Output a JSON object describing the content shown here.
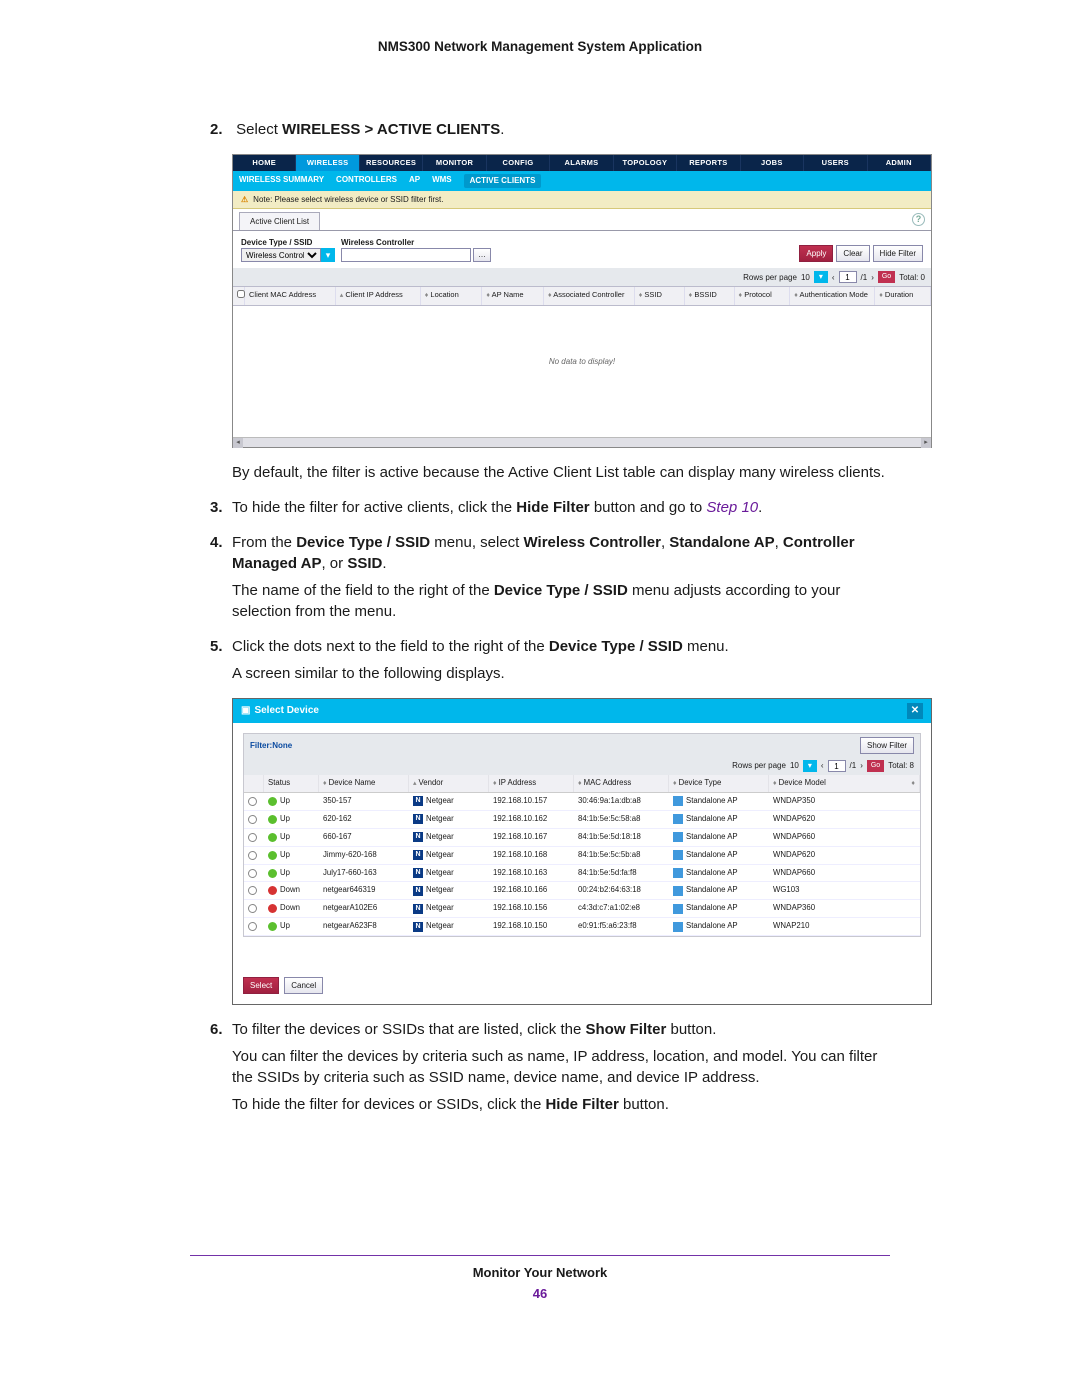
{
  "doc_title": "NMS300 Network Management System Application",
  "step2": {
    "num": "2.",
    "text_a": "Select ",
    "text_b": "WIRELESS > ACTIVE CLIENTS",
    "text_c": "."
  },
  "screenshot1": {
    "nav": [
      "HOME",
      "WIRELESS",
      "RESOURCES",
      "MONITOR",
      "CONFIG",
      "ALARMS",
      "TOPOLOGY",
      "REPORTS",
      "JOBS",
      "USERS",
      "ADMIN"
    ],
    "subnav": [
      "WIRELESS SUMMARY",
      "CONTROLLERS",
      "AP",
      "WMS",
      "ACTIVE CLIENTS"
    ],
    "note": "Note: Please select wireless device or SSID filter first.",
    "tab": "Active Client List",
    "filter_label": "Device Type / SSID",
    "filter_option": "Wireless Controller",
    "wc_label": "Wireless Controller",
    "btn_apply": "Apply",
    "btn_clear": "Clear",
    "btn_hide": "Hide Filter",
    "pager": {
      "rpp": "Rows per page",
      "val": "10",
      "page": "1",
      "of": "/1",
      "go": "Go",
      "total": "Total: 0"
    },
    "cols": [
      "Client MAC Address",
      "Client IP Address",
      "Location",
      "AP Name",
      "Associated Controller",
      "SSID",
      "BSSID",
      "Protocol",
      "Authentication Mode",
      "Duration"
    ],
    "empty": "No data to display!"
  },
  "step2_after": "By default, the filter is active because the Active Client List table can display many wireless clients.",
  "step3": {
    "num": "3.",
    "a": "To hide the filter for active clients, click the ",
    "b": "Hide Filter",
    "c": " button and go to ",
    "d": "Step 10",
    "e": "."
  },
  "step4": {
    "num": "4.",
    "a": "From the ",
    "b": "Device Type / SSID",
    "c": " menu, select ",
    "d": "Wireless Controller",
    "e": ", ",
    "f": "Standalone AP",
    "g": ", ",
    "h": "Controller Managed AP",
    "i": ", or ",
    "j": "SSID",
    "k": ".",
    "para": "The name of the field to the right of the ",
    "para_b": "Device Type / SSID",
    "para_c": " menu adjusts according to your selection from the menu."
  },
  "step5": {
    "num": "5.",
    "a": "Click the dots next to the field to the right of the ",
    "b": "Device Type / SSID",
    "c": " menu.",
    "d": "A screen similar to the following displays."
  },
  "dialog": {
    "title": "Select Device",
    "filter_label": "Filter:None",
    "show_filter": "Show Filter",
    "pager": {
      "rpp": "Rows per page",
      "val": "10",
      "page": "1",
      "of": "/1",
      "go": "Go",
      "total": "Total: 8"
    },
    "cols": [
      "",
      "Status",
      "Device Name",
      "Vendor",
      "IP Address",
      "MAC Address",
      "Device Type",
      "Device Model"
    ],
    "rows": [
      {
        "status": "Up",
        "name": "350-157",
        "vendor": "Netgear",
        "ip": "192.168.10.157",
        "mac": "30:46:9a:1a:db:a8",
        "type": "Standalone AP",
        "model": "WNDAP350"
      },
      {
        "status": "Up",
        "name": "620-162",
        "vendor": "Netgear",
        "ip": "192.168.10.162",
        "mac": "84:1b:5e:5c:58:a8",
        "type": "Standalone AP",
        "model": "WNDAP620"
      },
      {
        "status": "Up",
        "name": "660-167",
        "vendor": "Netgear",
        "ip": "192.168.10.167",
        "mac": "84:1b:5e:5d:18:18",
        "type": "Standalone AP",
        "model": "WNDAP660"
      },
      {
        "status": "Up",
        "name": "Jimmy-620-168",
        "vendor": "Netgear",
        "ip": "192.168.10.168",
        "mac": "84:1b:5e:5c:5b:a8",
        "type": "Standalone AP",
        "model": "WNDAP620"
      },
      {
        "status": "Up",
        "name": "July17-660-163",
        "vendor": "Netgear",
        "ip": "192.168.10.163",
        "mac": "84:1b:5e:5d:fa:f8",
        "type": "Standalone AP",
        "model": "WNDAP660"
      },
      {
        "status": "Down",
        "name": "netgear646319",
        "vendor": "Netgear",
        "ip": "192.168.10.166",
        "mac": "00:24:b2:64:63:18",
        "type": "Standalone AP",
        "model": "WG103"
      },
      {
        "status": "Down",
        "name": "netgearA102E6",
        "vendor": "Netgear",
        "ip": "192.168.10.156",
        "mac": "c4:3d:c7:a1:02:e8",
        "type": "Standalone AP",
        "model": "WNDAP360"
      },
      {
        "status": "Up",
        "name": "netgearA623F8",
        "vendor": "Netgear",
        "ip": "192.168.10.150",
        "mac": "e0:91:f5:a6:23:f8",
        "type": "Standalone AP",
        "model": "WNAP210"
      }
    ],
    "btn_select": "Select",
    "btn_cancel": "Cancel"
  },
  "step6": {
    "num": "6.",
    "a": "To filter the devices or SSIDs that are listed, click the ",
    "b": "Show Filter",
    "c": " button.",
    "p1": "You can filter the devices by criteria such as name, IP address, location, and model. You can filter the SSIDs by criteria such as SSID name, device name, and device IP address.",
    "p2a": "To hide the filter for devices or SSIDs, click the ",
    "p2b": "Hide Filter",
    "p2c": " button."
  },
  "footer": {
    "title": "Monitor Your Network",
    "page": "46"
  }
}
